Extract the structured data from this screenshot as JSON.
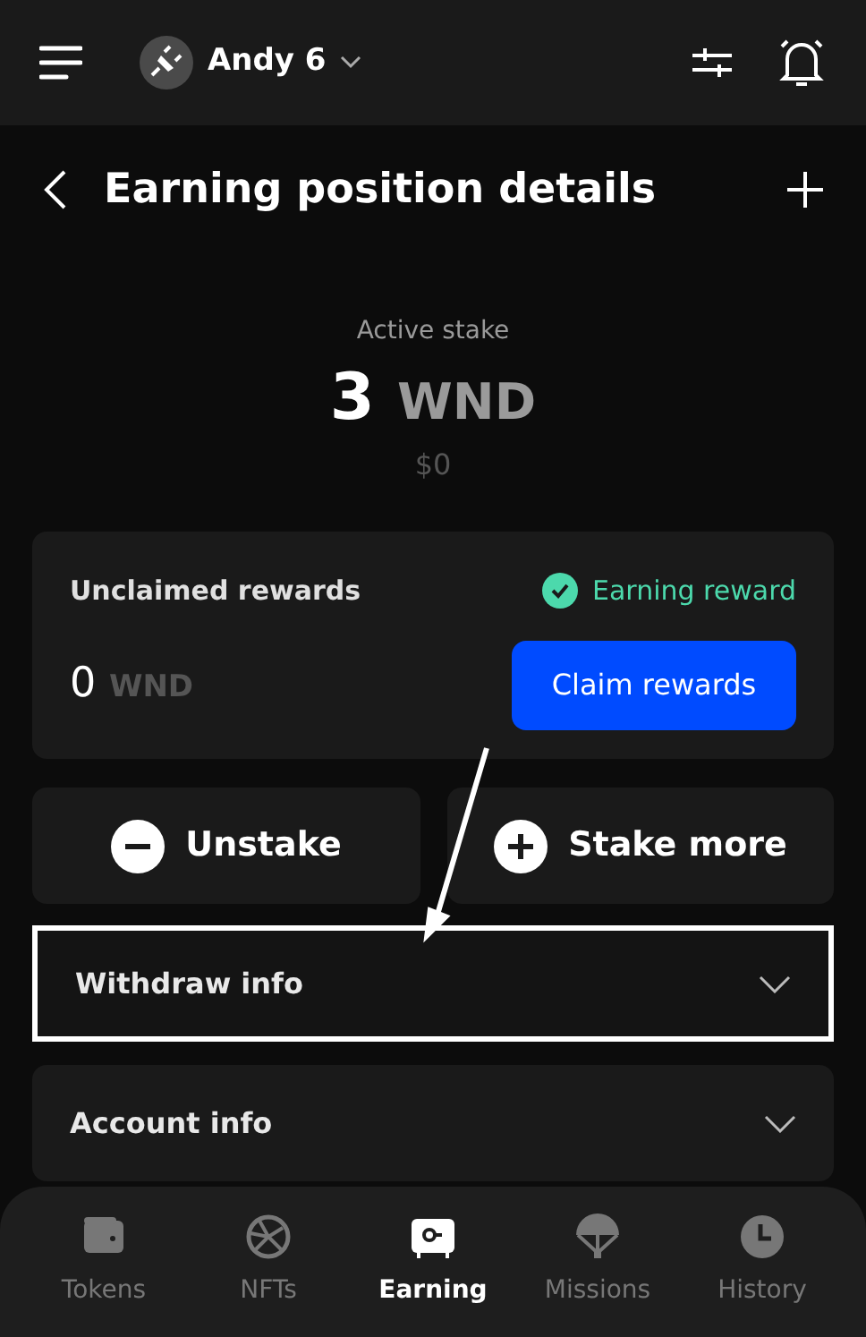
{
  "header": {
    "account": "Andy 6"
  },
  "page": {
    "title": "Earning position details"
  },
  "stake": {
    "label": "Active stake",
    "amount": "3",
    "symbol": "WND",
    "value": "$0"
  },
  "rewards": {
    "label": "Unclaimed rewards",
    "status": "Earning reward",
    "amount": "0",
    "symbol": "WND",
    "button": "Claim rewards"
  },
  "actions": [
    {
      "kind": "minus",
      "label": "Unstake"
    },
    {
      "kind": "plus",
      "label": "Stake more"
    }
  ],
  "sections": [
    {
      "label": "Withdraw info",
      "expanded": false,
      "highlighted": true
    },
    {
      "label": "Account info",
      "expanded": false,
      "highlighted": false
    }
  ],
  "nav": [
    {
      "kind": "wallet",
      "label": "Tokens",
      "selected": false
    },
    {
      "kind": "aperture",
      "label": "NFTs",
      "selected": false
    },
    {
      "kind": "safe",
      "label": "Earning",
      "selected": true
    },
    {
      "kind": "parachute",
      "label": "Missions",
      "selected": false
    },
    {
      "kind": "clock",
      "label": "History",
      "selected": false
    }
  ]
}
